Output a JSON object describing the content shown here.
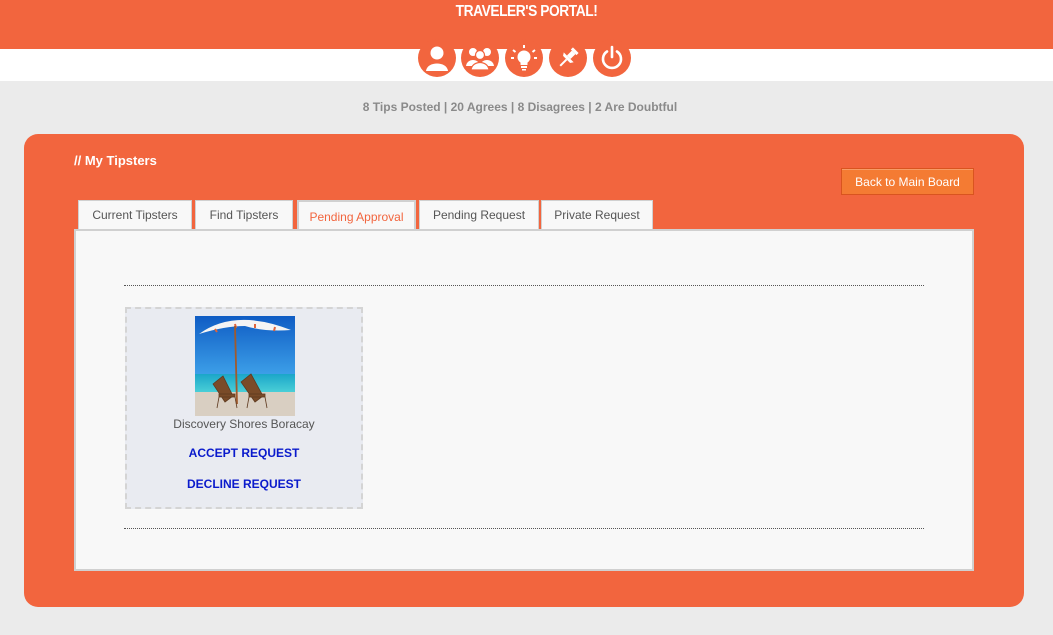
{
  "header": {
    "title": "TRAVELER'S PORTAL!"
  },
  "nav": {
    "icons": [
      "profile-icon",
      "group-icon",
      "lightbulb-icon",
      "pin-icon",
      "power-icon"
    ]
  },
  "stats": {
    "text": "8 Tips Posted | 20 Agrees | 8 Disagrees | 2 Are Doubtful"
  },
  "panel": {
    "title": "// My Tipsters",
    "back_button": "Back to Main Board"
  },
  "tabs": [
    {
      "label": "Current Tipsters"
    },
    {
      "label": "Find Tipsters"
    },
    {
      "label": "Pending Approval"
    },
    {
      "label": "Pending Request"
    },
    {
      "label": "Private Request"
    }
  ],
  "active_tab": "Pending Approval",
  "card": {
    "name": "Discovery Shores Boracay",
    "accept": "ACCEPT REQUEST",
    "decline": "DECLINE REQUEST"
  },
  "colors": {
    "brand": "#f2653e",
    "link": "#0a1acc"
  }
}
